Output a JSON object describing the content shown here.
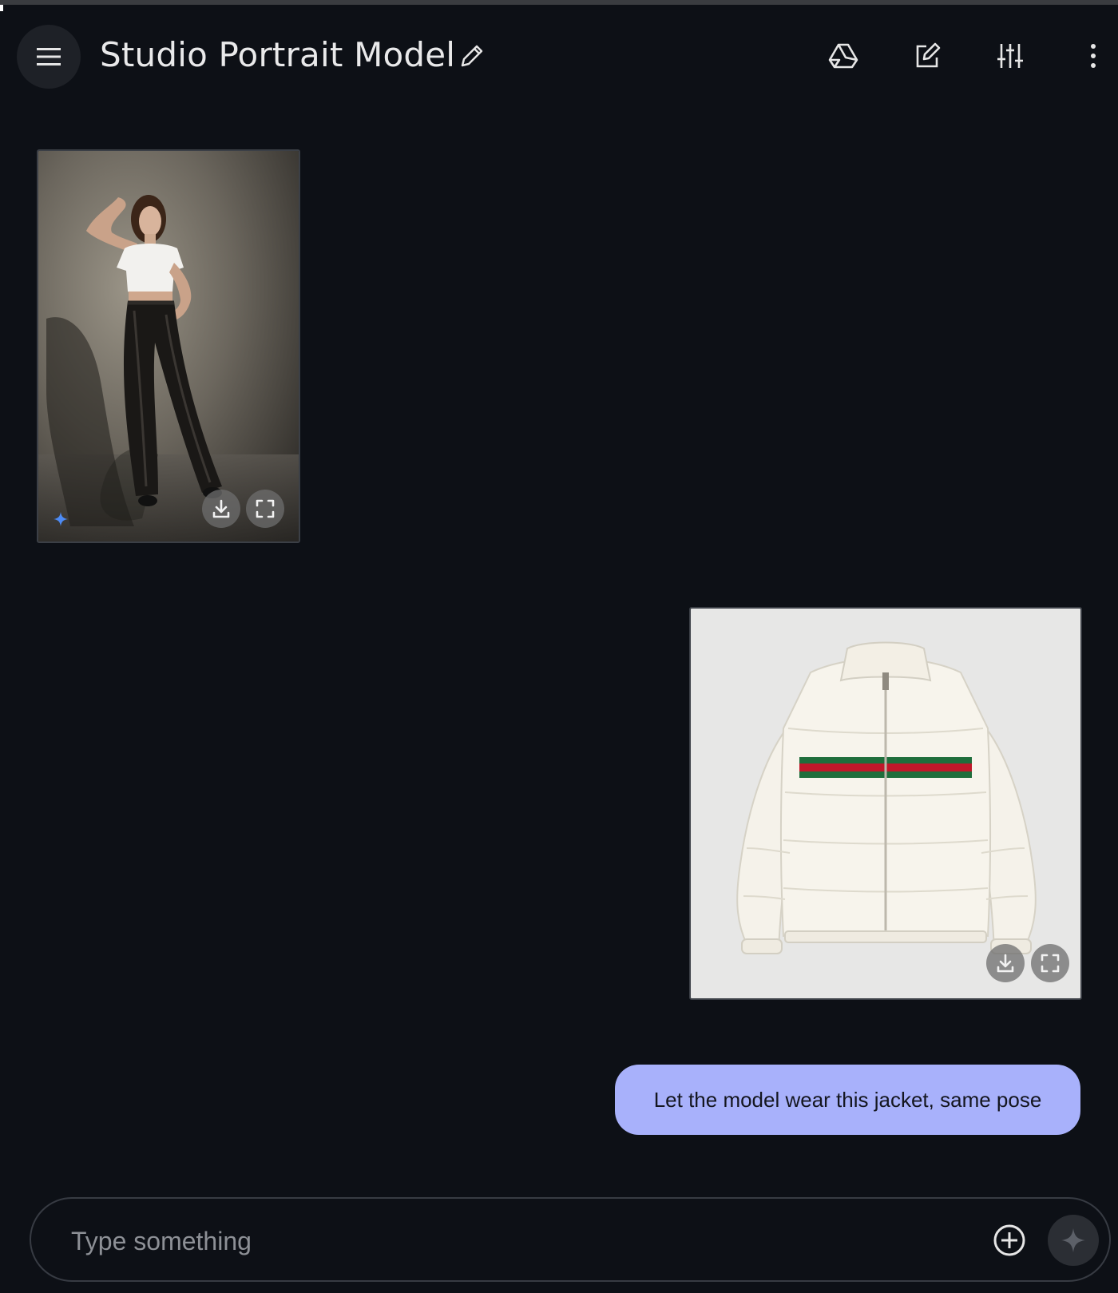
{
  "header": {
    "title": "Studio Portrait Model",
    "icons": [
      "menu-icon",
      "edit-title-icon",
      "drive-icon",
      "new-chat-icon",
      "tune-icon",
      "more-vert-icon"
    ]
  },
  "messages": [
    {
      "role": "model",
      "type": "image",
      "subject": "model-portrait",
      "actions": [
        "download-icon",
        "fullscreen-icon"
      ]
    },
    {
      "role": "user",
      "type": "image",
      "subject": "white-puffer-jacket",
      "actions": [
        "download-icon",
        "fullscreen-icon"
      ]
    },
    {
      "role": "user",
      "type": "text",
      "text": "Let the model wear this jacket, same pose"
    }
  ],
  "composer": {
    "placeholder": "Type something",
    "value": ""
  },
  "colors": {
    "background": "#0d1016",
    "user_bubble": "#a8b1fb",
    "jacket_red": "#c0182a",
    "jacket_green": "#1f6e3c"
  }
}
